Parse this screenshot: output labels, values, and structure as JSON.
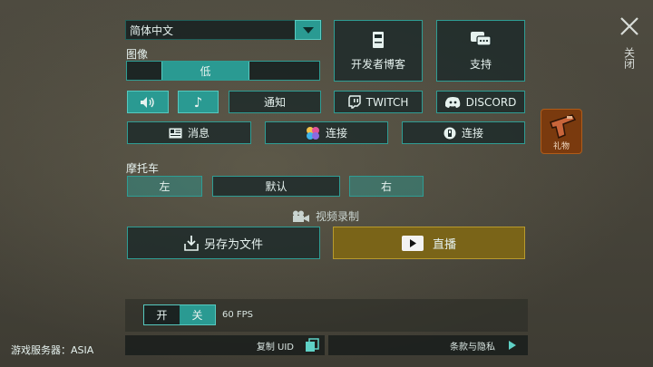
{
  "language": {
    "selected": "简体中文"
  },
  "graphics": {
    "label": "图像",
    "options": [
      "",
      "低",
      ""
    ],
    "selected_index": 1
  },
  "links": {
    "developer_blog": "开发者博客",
    "support": "支持"
  },
  "audio": {
    "notification": "通知"
  },
  "social": {
    "twitch": "TWITCH",
    "discord": "DISCORD"
  },
  "messages": {
    "news": "消息",
    "connect_1": "连接",
    "connect_2": "连接"
  },
  "gift": {
    "label": "礼物"
  },
  "motorcycle": {
    "label": "摩托车",
    "left": "左",
    "default": "默认",
    "right": "右"
  },
  "recording": {
    "label": "视频录制",
    "save_file": "另存为文件",
    "live": "直播"
  },
  "fps": {
    "on": "开",
    "off": "关",
    "value": "60 FPS"
  },
  "footer": {
    "server": "游戏服务器：ASIA",
    "copy_uid": "复制 UID",
    "terms": "条款与隐私"
  },
  "close": {
    "label": "关闭"
  },
  "colors": {
    "accent": "#2a9a92",
    "border": "#2f9d94",
    "live": "#7a6418",
    "gift": "#7a3a0e"
  }
}
